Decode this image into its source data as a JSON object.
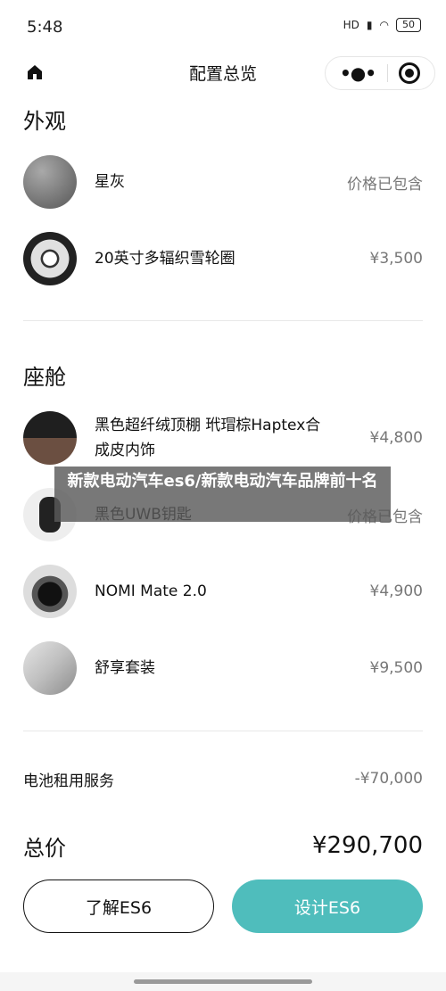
{
  "status_bar": {
    "time": "5:48",
    "network": "HD",
    "battery": "50"
  },
  "nav": {
    "title": "配置总览"
  },
  "exterior": {
    "title": "外观",
    "items": [
      {
        "name": "星灰",
        "price": "价格已包含"
      },
      {
        "name": "20英寸多辐织雪轮圈",
        "price": "¥3,500"
      }
    ]
  },
  "cabin": {
    "title": "座舱",
    "items": [
      {
        "name": "黑色超纤绒顶棚 玳瑁棕Haptex合成皮内饰",
        "price": "¥4,800"
      },
      {
        "name": "黑色UWB钥匙",
        "price": "价格已包含"
      },
      {
        "name": "NOMI Mate 2.0",
        "price": "¥4,900"
      },
      {
        "name": "舒享套装",
        "price": "¥9,500"
      }
    ]
  },
  "service": {
    "label": "电池租用服务",
    "price": "-¥70,000"
  },
  "total": {
    "label": "总价",
    "price": "¥290,700"
  },
  "buttons": {
    "learn": "了解ES6",
    "design": "设计ES6"
  },
  "overlay": {
    "text": "新款电动汽车es6/新款电动汽车品牌前十名"
  },
  "colors": {
    "accent": "#4fbdbc"
  }
}
